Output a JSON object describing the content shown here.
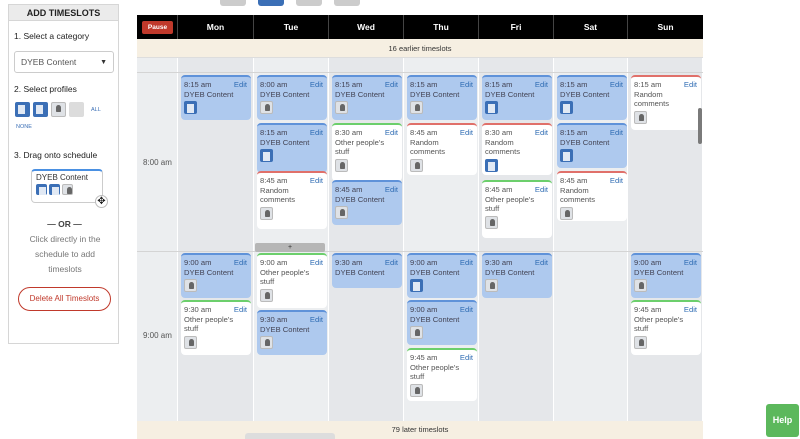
{
  "panel": {
    "title": "ADD TIMESLOTS",
    "step1": "1. Select a category",
    "category_value": "DYEB Content",
    "step2": "2. Select profiles",
    "all_link": "ALL",
    "none_link": "NONE",
    "step3": "3. Drag onto schedule",
    "drag_card_label": "DYEB Content",
    "or": "— OR —",
    "click_text": "Click directly in the schedule to add timeslots",
    "delete_all": "Delete All Timeslots"
  },
  "schedule": {
    "pause": "Pause",
    "days": [
      "Mon",
      "Tue",
      "Wed",
      "Thu",
      "Fri",
      "Sat",
      "Sun"
    ],
    "earlier": "16 earlier timeslots",
    "later": "79 later timeslots",
    "times": [
      "8:00 am",
      "9:00 am"
    ],
    "edit": "Edit",
    "plus": "+"
  },
  "slots": [
    {
      "day": "Mon",
      "time": "8:15 am",
      "label": "DYEB Content",
      "kind": "blue",
      "icon": "doc-icon"
    },
    {
      "day": "Tue",
      "time": "8:00 am",
      "label": "DYEB Content",
      "kind": "blue",
      "icon": "photo-icon"
    },
    {
      "day": "Tue",
      "time": "8:15 am",
      "label": "DYEB Content",
      "kind": "blue",
      "icon": "doc-icon"
    },
    {
      "day": "Tue",
      "time": "8:45 am",
      "label": "Random comments",
      "kind": "red",
      "icon": "photo-icon"
    },
    {
      "day": "Wed",
      "time": "8:15 am",
      "label": "DYEB Content",
      "kind": "blue",
      "icon": "photo-icon"
    },
    {
      "day": "Wed",
      "time": "8:30 am",
      "label": "Other people's stuff",
      "kind": "green",
      "icon": "photo-icon"
    },
    {
      "day": "Wed",
      "time": "8:45 am",
      "label": "DYEB Content",
      "kind": "blue",
      "icon": "photo-icon"
    },
    {
      "day": "Thu",
      "time": "8:15 am",
      "label": "DYEB Content",
      "kind": "blue",
      "icon": "photo-icon"
    },
    {
      "day": "Thu",
      "time": "8:45 am",
      "label": "Random comments",
      "kind": "red",
      "icon": "photo-icon"
    },
    {
      "day": "Fri",
      "time": "8:15 am",
      "label": "DYEB Content",
      "kind": "blue",
      "icon": "doc-icon"
    },
    {
      "day": "Fri",
      "time": "8:30 am",
      "label": "Random comments",
      "kind": "red",
      "icon": "doc-icon"
    },
    {
      "day": "Fri",
      "time": "8:45 am",
      "label": "Other people's stuff",
      "kind": "green",
      "icon": "photo-icon"
    },
    {
      "day": "Sat",
      "time": "8:15 am",
      "label": "DYEB Content",
      "kind": "blue",
      "icon": "doc-icon"
    },
    {
      "day": "Sat",
      "time": "8:15 am",
      "label": "DYEB Content",
      "kind": "blue",
      "icon": "doc-icon"
    },
    {
      "day": "Sat",
      "time": "8:45 am",
      "label": "Random comments",
      "kind": "red",
      "icon": "photo-icon"
    },
    {
      "day": "Sun",
      "time": "8:15 am",
      "label": "Random comments",
      "kind": "red",
      "icon": "photo-icon"
    },
    {
      "day": "Mon",
      "time": "9:00 am",
      "label": "DYEB Content",
      "kind": "blue",
      "icon": "photo-icon"
    },
    {
      "day": "Mon",
      "time": "9:30 am",
      "label": "Other people's stuff",
      "kind": "green",
      "icon": "photo-icon"
    },
    {
      "day": "Tue",
      "time": "9:00 am",
      "label": "Other people's stuff",
      "kind": "green",
      "icon": "photo-icon"
    },
    {
      "day": "Tue",
      "time": "9:30 am",
      "label": "DYEB Content",
      "kind": "blue",
      "icon": "photo-icon"
    },
    {
      "day": "Wed",
      "time": "9:30 am",
      "label": "DYEB Content",
      "kind": "blue",
      "icon": "none"
    },
    {
      "day": "Thu",
      "time": "9:00 am",
      "label": "DYEB Content",
      "kind": "blue",
      "icon": "doc-icon"
    },
    {
      "day": "Thu",
      "time": "9:00 am",
      "label": "DYEB Content",
      "kind": "blue",
      "icon": "photo-icon"
    },
    {
      "day": "Thu",
      "time": "9:45 am",
      "label": "Other people's stuff",
      "kind": "green",
      "icon": "photo-icon"
    },
    {
      "day": "Fri",
      "time": "9:30 am",
      "label": "DYEB Content",
      "kind": "blue",
      "icon": "photo-icon"
    },
    {
      "day": "Sun",
      "time": "9:00 am",
      "label": "DYEB Content",
      "kind": "blue",
      "icon": "photo-icon"
    },
    {
      "day": "Sun",
      "time": "9:45 am",
      "label": "Other people's stuff",
      "kind": "green",
      "icon": "photo-icon"
    }
  ],
  "help": "Help",
  "colors": {
    "accent": "#3b6fb6",
    "pause": "#c0392b",
    "help": "#5cb85c",
    "slot_blue": "#aec9ee"
  }
}
